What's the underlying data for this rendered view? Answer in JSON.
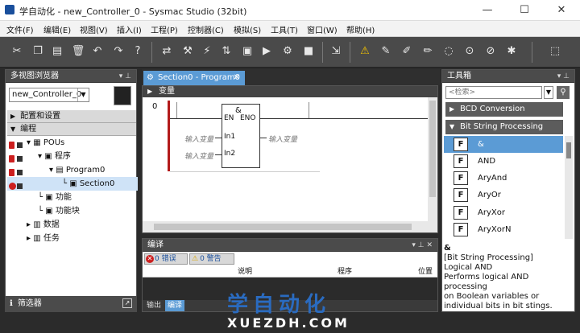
{
  "window": {
    "title": "学自动化 - new_Controller_0 - Sysmac Studio (32bit)",
    "minimize": "—",
    "maximize": "☐",
    "close": "✕"
  },
  "menu": [
    "文件(F)",
    "编辑(E)",
    "视图(V)",
    "插入(I)",
    "工程(P)",
    "控制器(C)",
    "模拟(S)",
    "工具(T)",
    "窗口(W)",
    "帮助(H)"
  ],
  "left_panel": {
    "title": "多视图浏览器",
    "pin": "▾ 𝅂",
    "controller": "new_Controller_0",
    "sections": [
      "配置和设置",
      "编程"
    ],
    "tree": [
      {
        "label": "POUs"
      },
      {
        "label": "程序"
      },
      {
        "label": "Program0"
      },
      {
        "label": "Section0"
      },
      {
        "label": "功能"
      },
      {
        "label": "功能块"
      },
      {
        "label": "数据"
      },
      {
        "label": "任务"
      }
    ],
    "filter": "筛选器"
  },
  "editor": {
    "tab": "Section0 - Program0",
    "tab_close": "✕",
    "var_label": "变量",
    "rung_number": "0",
    "block": {
      "name": "&",
      "en": "EN",
      "eno": "ENO",
      "in1": "In1",
      "in2": "In2"
    },
    "input_var": "输入变量"
  },
  "compile_panel": {
    "title": "编译",
    "errors": "0 错误",
    "warnings": "0 警告",
    "columns": [
      "说明",
      "程序",
      "位置"
    ],
    "tabs": [
      "输出",
      "编译"
    ]
  },
  "toolbox": {
    "title": "工具箱",
    "search_placeholder": "<检索>",
    "categories": [
      "BCD Conversion",
      "Bit String Processing"
    ],
    "items": [
      "&",
      "AND",
      "AryAnd",
      "AryOr",
      "AryXor",
      "AryXorN"
    ],
    "item_icon": "F",
    "description": {
      "name": "&",
      "category": "[Bit String Processing]",
      "line1": "Logical AND",
      "line2": "Performs logical AND processing",
      "line3": "on Boolean variables or",
      "line4": "individual bits in bit stings."
    }
  },
  "watermark": {
    "cn": "学自动化",
    "url": "XUEZDH.COM"
  }
}
